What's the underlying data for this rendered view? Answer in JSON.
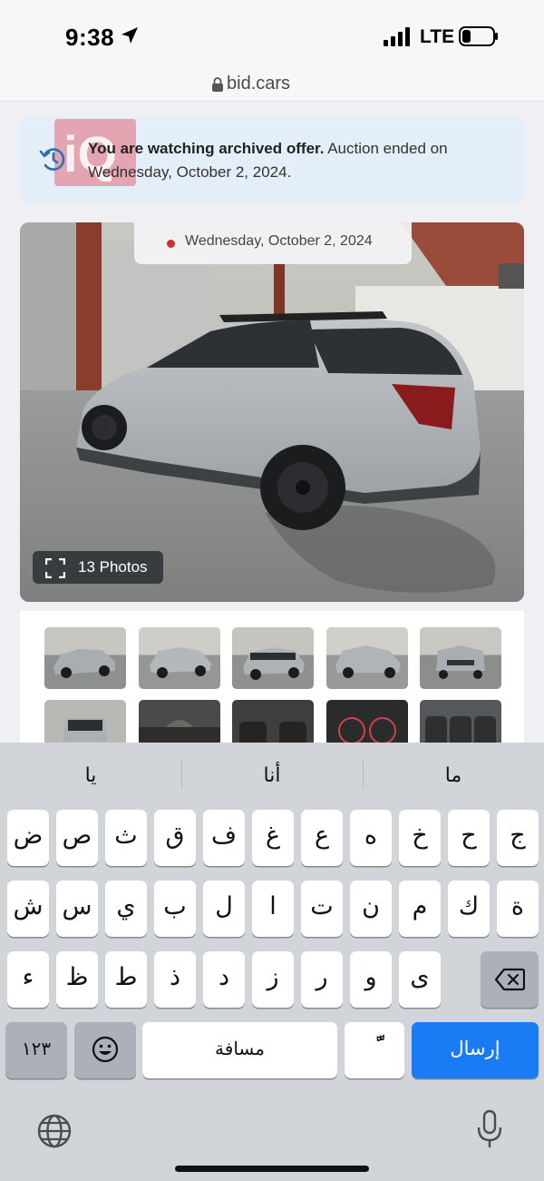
{
  "status_bar": {
    "time": "9:38",
    "network": "LTE"
  },
  "url_bar": {
    "domain": "bid.cars"
  },
  "notice": {
    "bold": "You are watching archived offer.",
    "rest": " Auction ended on Wednesday, October 2, 2024."
  },
  "listing": {
    "date": "Wednesday, October 2, 2024",
    "photos_label": "13 Photos",
    "thumbnail_count": 10
  },
  "keyboard": {
    "suggestions": [
      "يا",
      "أنا",
      "ما"
    ],
    "row1": [
      "ض",
      "ص",
      "ث",
      "ق",
      "ف",
      "غ",
      "ع",
      "ه",
      "خ",
      "ح",
      "ج"
    ],
    "row2": [
      "ش",
      "س",
      "ي",
      "ب",
      "ل",
      "ا",
      "ت",
      "ن",
      "م",
      "ك",
      "ة"
    ],
    "row3": [
      "ء",
      "ظ",
      "ط",
      "ذ",
      "د",
      "ز",
      "ر",
      "و",
      "ى"
    ],
    "numbers_key": "١٢٣",
    "space_label": "مسافة",
    "diacritic_key": "ًّ",
    "send_label": "إرسال"
  },
  "colors": {
    "accent": "#1a7cf5",
    "notice_bg": "#e3eef8",
    "live_dot": "#d32f2f"
  }
}
